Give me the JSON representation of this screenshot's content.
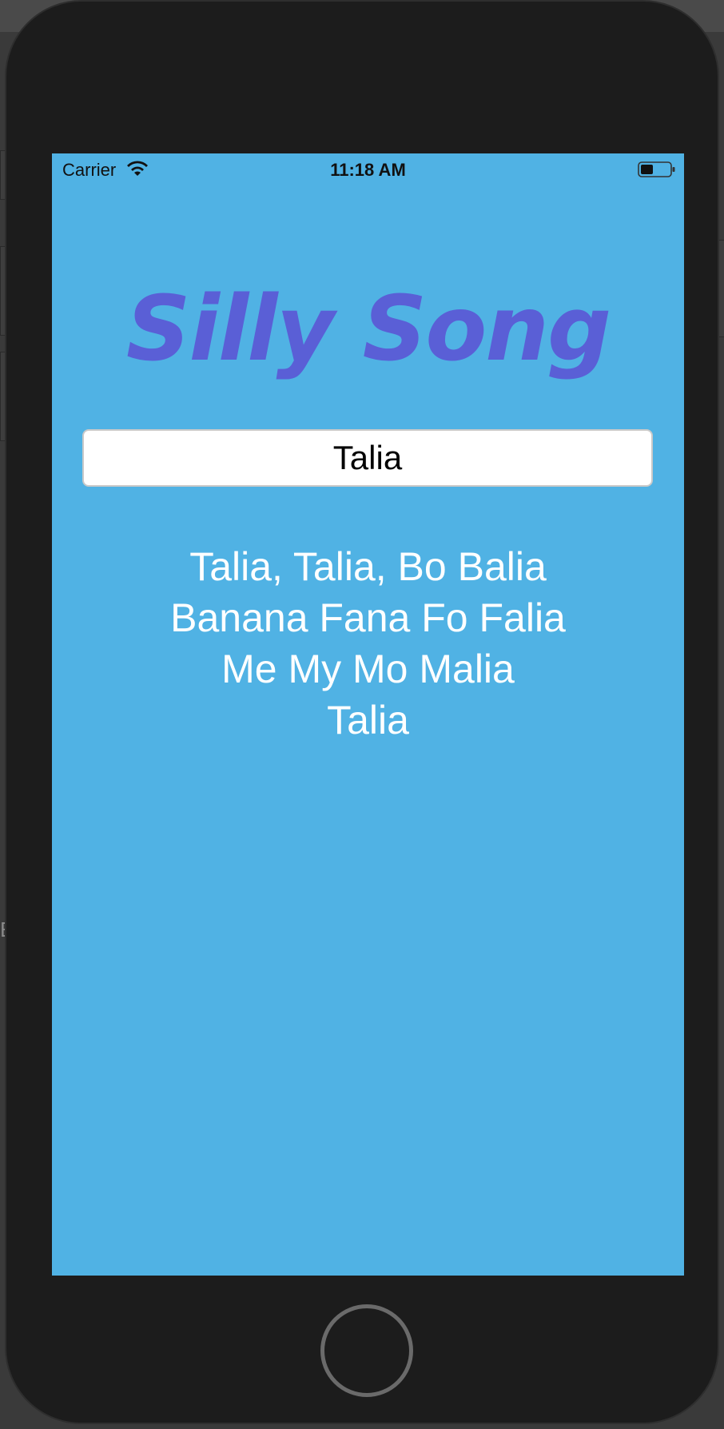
{
  "status_bar": {
    "carrier": "Carrier",
    "time": "11:18 AM",
    "wifi_icon": "wifi-icon",
    "battery_icon": "battery-icon"
  },
  "app": {
    "title": "Silly Song",
    "name_field": {
      "value": "Talia",
      "placeholder": ""
    },
    "lyrics": [
      "Talia, Talia, Bo Balia",
      "Banana Fana Fo Falia",
      "Me My Mo Malia",
      "Talia"
    ]
  },
  "colors": {
    "screen_background": "#50b2e4",
    "title": "#5a5fd6",
    "lyrics": "#ffffff"
  },
  "device": {
    "home_button_icon": "home-button"
  },
  "background": {
    "partial_label": "E"
  }
}
